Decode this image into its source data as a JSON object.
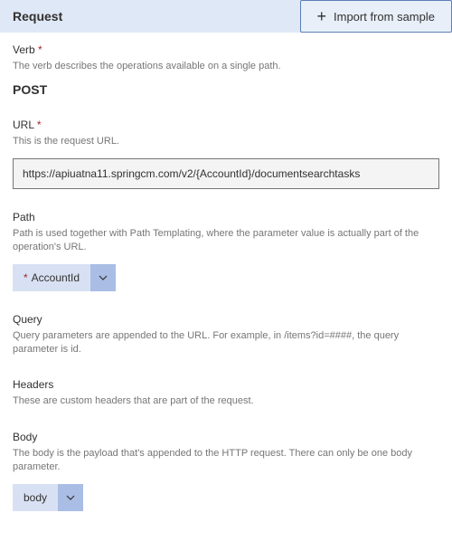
{
  "header": {
    "title": "Request",
    "import_label": "Import from sample"
  },
  "verb": {
    "label": "Verb",
    "desc": "The verb describes the operations available on a single path.",
    "value": "POST"
  },
  "url": {
    "label": "URL",
    "desc": "This is the request URL.",
    "value": "https://apiuatna11.springcm.com/v2/{AccountId}/documentsearchtasks"
  },
  "path": {
    "label": "Path",
    "desc": "Path is used together with Path Templating, where the parameter value is actually part of the operation's URL.",
    "chip": "AccountId"
  },
  "query": {
    "label": "Query",
    "desc": "Query parameters are appended to the URL. For example, in /items?id=####, the query parameter is id."
  },
  "headers": {
    "label": "Headers",
    "desc": "These are custom headers that are part of the request."
  },
  "body": {
    "label": "Body",
    "desc": "The body is the payload that's appended to the HTTP request. There can only be one body parameter.",
    "chip": "body"
  },
  "icons": {
    "plus": "+",
    "required": "*"
  }
}
